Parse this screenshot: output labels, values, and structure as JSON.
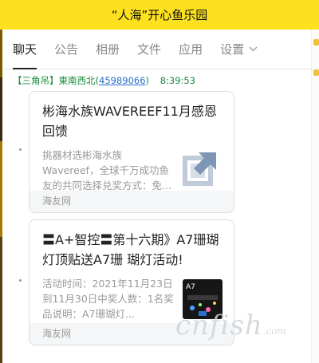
{
  "window": {
    "title": "“人海”开心鱼乐园"
  },
  "tabs": [
    {
      "label": "聊天",
      "active": true
    },
    {
      "label": "公告",
      "active": false
    },
    {
      "label": "相册",
      "active": false
    },
    {
      "label": "文件",
      "active": false
    },
    {
      "label": "应用",
      "active": false
    },
    {
      "label": "设置",
      "active": false,
      "has_dropdown": true
    }
  ],
  "message": {
    "sender_tag": "【三角吊】",
    "sender_name": "東南西北",
    "sender_id_open": "(",
    "sender_id": "45989066",
    "sender_id_close": ")",
    "time": "8:39:53"
  },
  "cards": [
    {
      "title": "彬海水族WAVEREEF11月感恩回馈",
      "description": "挑器材选彬海水族Wavereef，全球千万成功鱼友的共同选择兑奖方式：免...",
      "source": "海友网",
      "thumbnail_icon": "share-link-icon"
    },
    {
      "title": "〓A+智控〓第十六期》A7珊瑚灯顶贴送A7珊 瑚灯活动!",
      "description": "活动时间：2021年11月23日到11月30日中奖人数：1名奖品说明：A7珊瑚灯...",
      "source": "海友网",
      "thumbnail_icon": "aquarium-photo-icon"
    }
  ],
  "watermark": {
    "brand": "cnfish",
    "suffix": ".com"
  },
  "colors": {
    "titlebar": "#fde11f",
    "sender_green": "#1a8a3a",
    "link_blue": "#2a6fc9"
  }
}
